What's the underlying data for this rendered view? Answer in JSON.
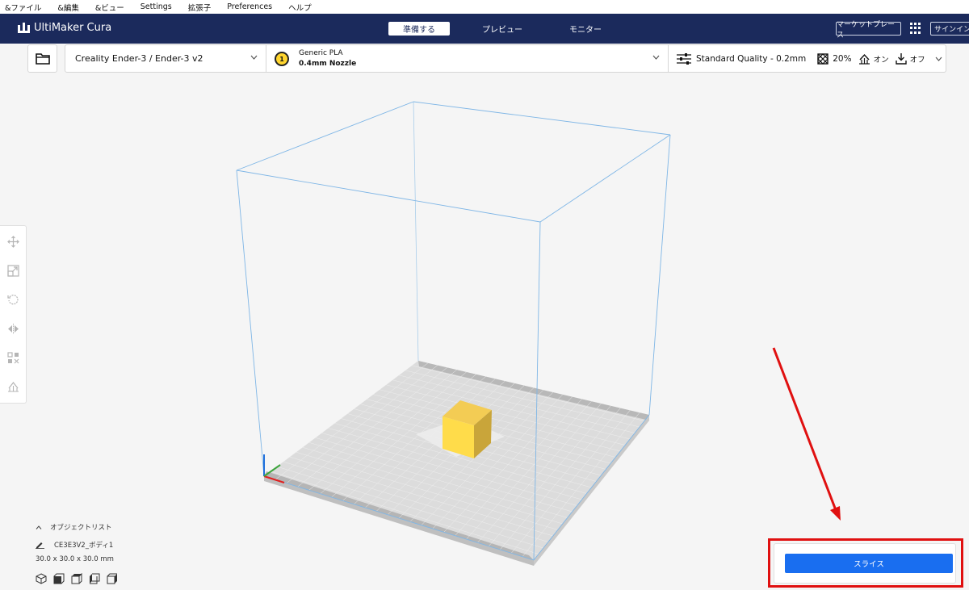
{
  "menu": [
    {
      "label": "&ファイル"
    },
    {
      "label": "&編集"
    },
    {
      "label": "&ビュー"
    },
    {
      "label": "Settings"
    },
    {
      "label": "拡張子"
    },
    {
      "label": "Preferences"
    },
    {
      "label": "ヘルプ"
    }
  ],
  "header": {
    "app_name": "UltiMaker Cura",
    "stages": [
      {
        "label": "準備する",
        "active": true
      },
      {
        "label": "プレビュー",
        "active": false
      },
      {
        "label": "モニター",
        "active": false
      }
    ],
    "marketplace_label": "マーケットプレース",
    "signin_label": "サインイン"
  },
  "toolbar": {
    "printer_name": "Creality Ender-3 / Ender-3 v2",
    "extruder_number": "1",
    "material_name": "Generic PLA",
    "nozzle_name": "0.4mm Nozzle",
    "quality_label": "Standard Quality - 0.2mm",
    "infill_value": "20%",
    "support_value": "オン",
    "adhesion_value": "オフ"
  },
  "left_tools": [
    {
      "icon": "move-icon"
    },
    {
      "icon": "scale-icon"
    },
    {
      "icon": "rotate-icon"
    },
    {
      "icon": "mirror-icon"
    },
    {
      "icon": "per-model-settings-icon"
    },
    {
      "icon": "support-blocker-icon"
    }
  ],
  "object_list": {
    "toggle_label": "オブジェクトリスト",
    "object_name": "CE3E3V2_ボディ1",
    "dimensions": "30.0 x 30.0 x 30.0 mm"
  },
  "view_buttons": [
    {
      "icon": "view-3d-icon"
    },
    {
      "icon": "view-front-icon"
    },
    {
      "icon": "view-top-icon"
    },
    {
      "icon": "view-left-icon"
    },
    {
      "icon": "view-right-icon"
    }
  ],
  "slice": {
    "button_label": "スライス"
  },
  "colors": {
    "header_bg": "#1b2a5c",
    "slice_button": "#196ef0",
    "build_volume_line": "#7fb6e6",
    "model_cube": "#ffd84a",
    "annotation": "#e01010"
  }
}
